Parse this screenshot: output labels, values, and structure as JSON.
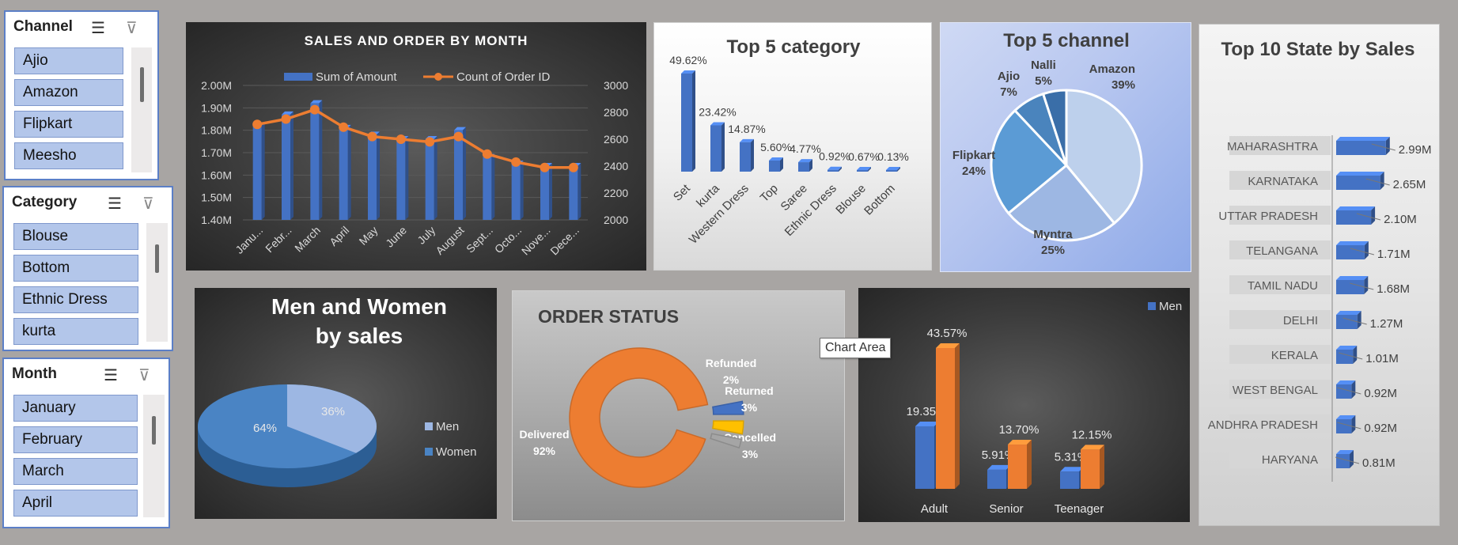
{
  "slicers": {
    "channel": {
      "title": "Channel",
      "items": [
        "Ajio",
        "Amazon",
        "Flipkart",
        "Meesho"
      ]
    },
    "category": {
      "title": "Category",
      "items": [
        "Blouse",
        "Bottom",
        "Ethnic Dress",
        "kurta"
      ]
    },
    "month": {
      "title": "Month",
      "items": [
        "January",
        "February",
        "March",
        "April"
      ]
    }
  },
  "tooltip": "Chart Area",
  "colors": {
    "bar_blue": "#4472c4",
    "orange": "#ed7d31",
    "dark_panel": "#3a3a3a"
  },
  "chart_data": [
    {
      "id": "sales-order-month",
      "type": "bar",
      "title": "SALES AND ORDER BY MONTH",
      "categories": [
        "Janu...",
        "Febr...",
        "March",
        "April",
        "May",
        "June",
        "July",
        "August",
        "Sept...",
        "Octo...",
        "Nove...",
        "Dece..."
      ],
      "series": [
        {
          "name": "Sum of Amount",
          "type": "bar",
          "axis": "left",
          "values": [
            1.82,
            1.87,
            1.92,
            1.81,
            1.78,
            1.76,
            1.76,
            1.8,
            1.68,
            1.65,
            1.64,
            1.64
          ]
        },
        {
          "name": "Count of Order ID",
          "type": "line",
          "axis": "right",
          "values": [
            2710,
            2750,
            2820,
            2690,
            2620,
            2600,
            2580,
            2620,
            2490,
            2430,
            2390,
            2390
          ]
        }
      ],
      "left_ticks": [
        "2.00M",
        "1.90M",
        "1.80M",
        "1.70M",
        "1.60M",
        "1.50M",
        "1.40M"
      ],
      "right_ticks": [
        "3000",
        "2800",
        "2600",
        "2400",
        "2200",
        "2000"
      ],
      "ylim_left": [
        1.4,
        2.0
      ],
      "ylim_right": [
        2000,
        3000
      ],
      "legend": "top"
    },
    {
      "id": "top5-category",
      "type": "bar",
      "title": "Top 5 category",
      "categories": [
        "Set",
        "kurta",
        "Western Dress",
        "Top",
        "Saree",
        "Ethnic Dress",
        "Blouse",
        "Bottom"
      ],
      "values": [
        49.62,
        23.42,
        14.87,
        5.6,
        4.77,
        0.92,
        0.67,
        0.13
      ],
      "labels": [
        "49.62%",
        "23.42%",
        "14.87%",
        "5.60%",
        "4.77%",
        "0.92%",
        "0.67%",
        "0.13%"
      ]
    },
    {
      "id": "top5-channel",
      "type": "pie",
      "title": "Top 5 channel",
      "slices": [
        {
          "name": "Amazon",
          "pct": 39,
          "label": "39%",
          "color": "#bdd0ec"
        },
        {
          "name": "Myntra",
          "pct": 25,
          "label": "25%",
          "color": "#9db7e3"
        },
        {
          "name": "Flipkart",
          "pct": 24,
          "label": "24%",
          "color": "#5b9bd5"
        },
        {
          "name": "Ajio",
          "pct": 7,
          "label": "7%",
          "color": "#4a84bd"
        },
        {
          "name": "Nalli",
          "pct": 5,
          "label": "5%",
          "color": "#3a6ea8"
        }
      ]
    },
    {
      "id": "top10-state",
      "type": "bar",
      "title": "Top 10 State by Sales",
      "categories": [
        "MAHARASHTRA",
        "KARNATAKA",
        "UTTAR PRADESH",
        "TELANGANA",
        "TAMIL NADU",
        "DELHI",
        "KERALA",
        "WEST BENGAL",
        "ANDHRA PRADESH",
        "HARYANA"
      ],
      "values": [
        2.99,
        2.65,
        2.1,
        1.71,
        1.68,
        1.27,
        1.01,
        0.92,
        0.92,
        0.81
      ],
      "labels": [
        "2.99M",
        "2.65M",
        "2.10M",
        "1.71M",
        "1.68M",
        "1.27M",
        "1.01M",
        "0.92M",
        "0.92M",
        "0.81M"
      ]
    },
    {
      "id": "men-women",
      "type": "pie",
      "title": "Men and Women by sales",
      "slices": [
        {
          "name": "Men",
          "pct": 36,
          "label": "36%",
          "color": "#9db7e3"
        },
        {
          "name": "Women",
          "pct": 64,
          "label": "64%",
          "color": "#4a84c4"
        }
      ],
      "legend": "right"
    },
    {
      "id": "order-status",
      "type": "pie",
      "title": "ORDER STATUS",
      "slices": [
        {
          "name": "Delivered",
          "pct": 92,
          "label": "92%",
          "color": "#ed7d31"
        },
        {
          "name": "Cancelled",
          "pct": 3,
          "label": "3%",
          "color": "#4472c4"
        },
        {
          "name": "Returned",
          "pct": 3,
          "label": "3%",
          "color": "#ffc000"
        },
        {
          "name": "Refunded",
          "pct": 2,
          "label": "2%",
          "color": "#a5a5a5"
        }
      ]
    },
    {
      "id": "age-group",
      "type": "bar",
      "categories": [
        "Adult",
        "Senior",
        "Teenager"
      ],
      "series": [
        {
          "name": "Men",
          "values": [
            19.35,
            5.91,
            5.31
          ],
          "labels": [
            "19.35%",
            "5.91%",
            "5.31%"
          ]
        },
        {
          "name": "",
          "values": [
            43.57,
            13.7,
            12.15
          ],
          "labels": [
            "43.57%",
            "13.70%",
            "12.15%"
          ]
        }
      ],
      "legend": "top-right"
    }
  ]
}
